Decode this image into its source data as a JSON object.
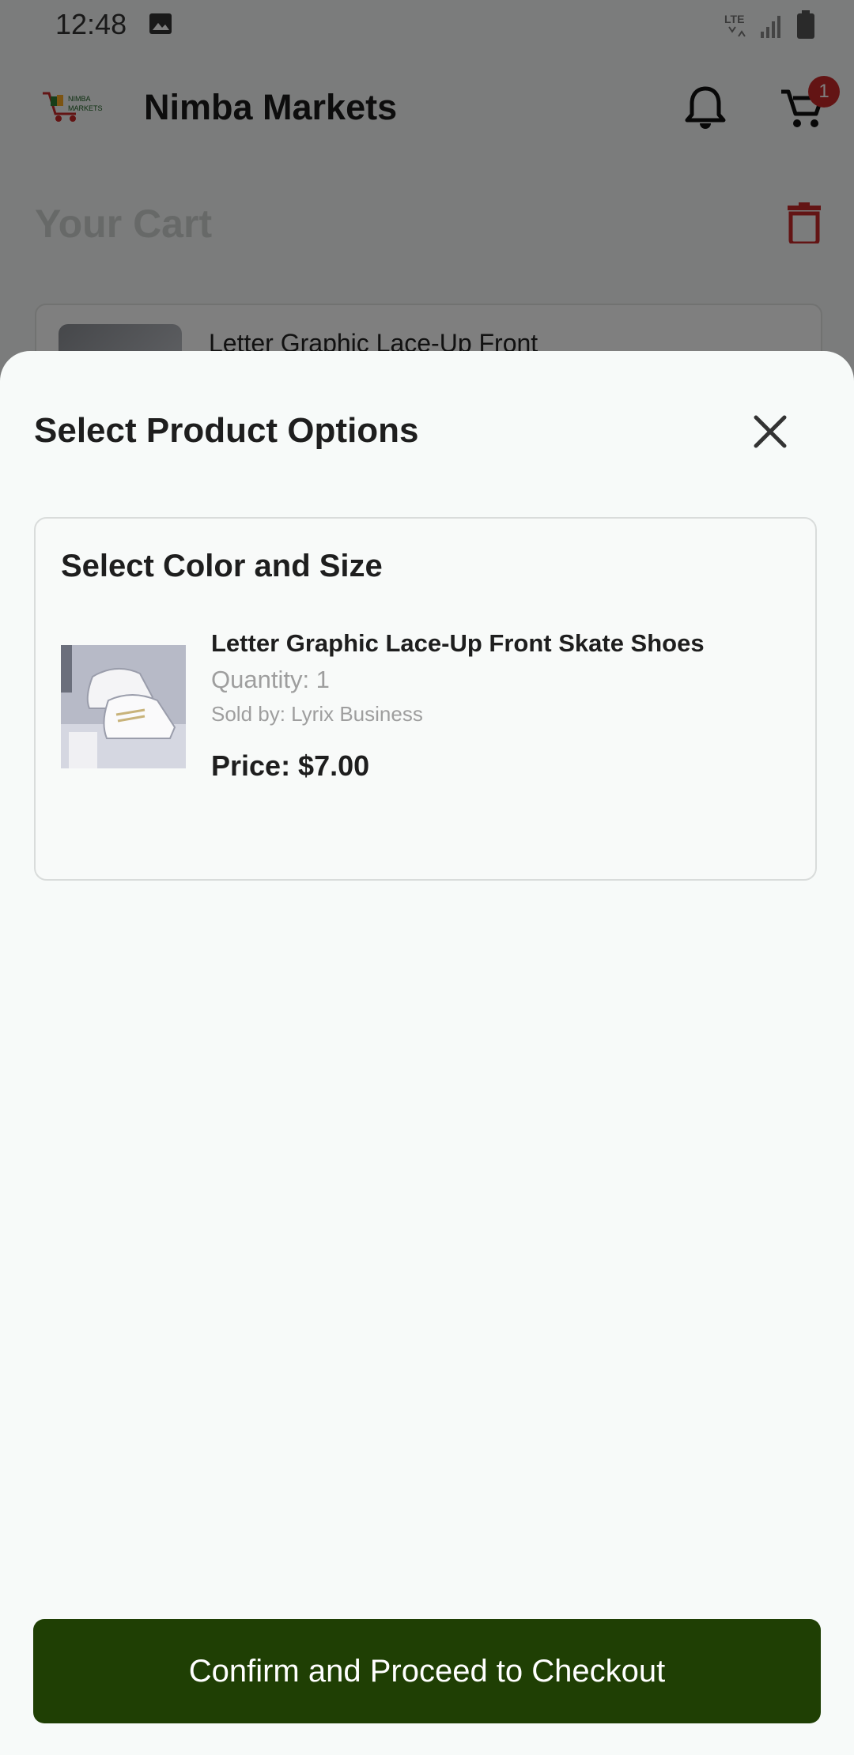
{
  "status_bar": {
    "time": "12:48",
    "network": "LTE"
  },
  "app_bar": {
    "logo_text": "NIMBA MARKETS",
    "title": "Nimba Markets",
    "cart_badge": "1"
  },
  "cart": {
    "title": "Your Cart",
    "item_name": "Letter Graphic Lace-Up Front"
  },
  "sheet": {
    "title": "Select Product Options",
    "card_title": "Select Color and Size",
    "product": {
      "name": "Letter Graphic Lace-Up Front Skate Shoes",
      "quantity": "Quantity: 1",
      "seller": "Sold by: Lyrix Business",
      "price": "Price: $7.00"
    },
    "confirm_label": "Confirm and Proceed to Checkout"
  },
  "colors": {
    "primary": "#1f3f04",
    "badge": "#c62828",
    "trash": "#c62828"
  },
  "icons": [
    "image-icon",
    "signal-icon",
    "battery-icon",
    "bell-icon",
    "cart-icon",
    "trash-icon",
    "close-icon"
  ]
}
